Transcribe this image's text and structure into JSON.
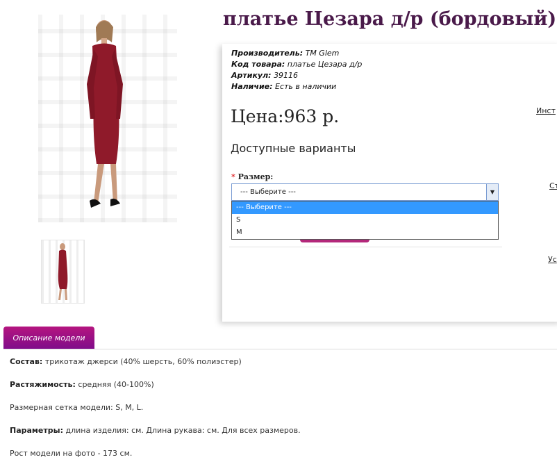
{
  "product": {
    "title": "платье Цезара д/р (бордовый)",
    "manufacturer_label": "Производитель:",
    "manufacturer_value": "TM Glem",
    "code_label": "Код товара:",
    "code_value": "платье Цезара д/р",
    "sku_label": "Артикул:",
    "sku_value": "39116",
    "stock_label": "Наличие:",
    "stock_value": "Есть в наличии",
    "price": "Цена:963 р.",
    "variants_heading": "Доступные варианты",
    "size_required_mark": "*",
    "size_label": "Размер:",
    "size_selected": "--- Выберите ---",
    "size_options": [
      "--- Выберите ---",
      "S",
      "M"
    ]
  },
  "side_links": [
    "Инст",
    "Ст",
    "Ус"
  ],
  "tabs": {
    "description": "Описание модели"
  },
  "description": {
    "composition_label": "Состав:",
    "composition_value": "трикотаж джерси (40% шерсть, 60% полиэстер)",
    "stretch_label": "Растяжимость:",
    "stretch_value": "средняя (40-100%)",
    "sizes_label": "Размерная сетка модели:",
    "sizes_value": "S, M, L.",
    "params_label": "Параметры:",
    "params_value": "длина изделия: см. Длина рукава: см. Для всех размеров.",
    "model_height": "Рост модели на фото - 173 см."
  },
  "colors": {
    "title": "#4a1a4a",
    "accent": "#b3287a",
    "tab": "#9b0f86",
    "dress": "#8f1a2a",
    "selected_option": "#3399ff"
  }
}
